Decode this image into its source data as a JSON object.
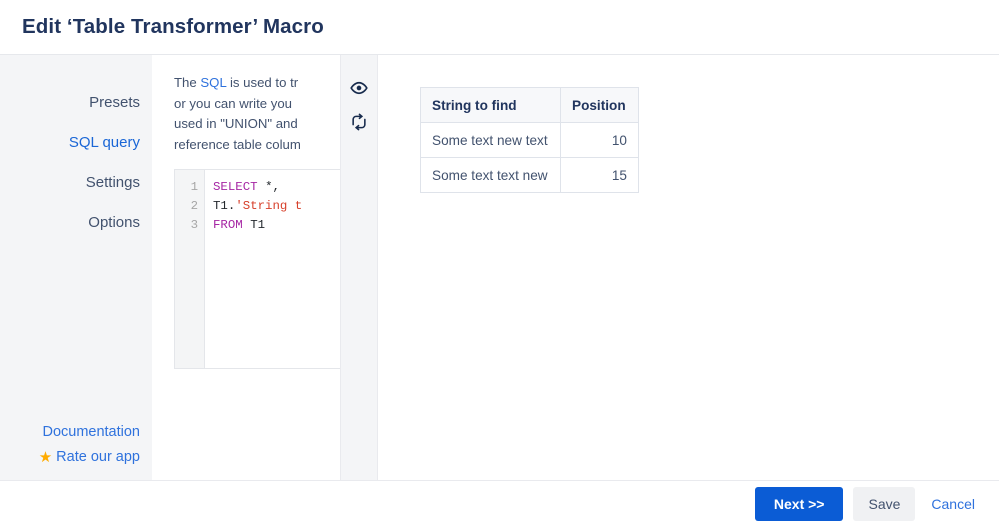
{
  "header": {
    "title": "Edit ‘Table Transformer’ Macro"
  },
  "sidebar": {
    "items": [
      {
        "label": "Presets",
        "active": false
      },
      {
        "label": "SQL query",
        "active": true
      },
      {
        "label": "Settings",
        "active": false
      },
      {
        "label": "Options",
        "active": false
      }
    ],
    "footer": {
      "documentation_label": "Documentation",
      "rate_label": "Rate our app",
      "star_glyph": "★",
      "star_icon_name": "star-icon",
      "star_color": "#ffab00"
    }
  },
  "config": {
    "description_lines": [
      {
        "pre": "The ",
        "link": "SQL",
        "post": " is used to tr"
      },
      {
        "pre": "or you can write you",
        "link": "",
        "post": ""
      },
      {
        "pre": "used in \"UNION\" and",
        "link": "",
        "post": ""
      },
      {
        "pre": "reference table colum",
        "link": "",
        "post": ""
      }
    ],
    "editor": {
      "line_numbers": [
        "1",
        "2",
        "3"
      ],
      "lines": [
        [
          {
            "t": "SELECT",
            "c": "kw"
          },
          {
            "t": " ",
            "c": "op"
          },
          {
            "t": "*,",
            "c": "op"
          }
        ],
        [
          {
            "t": "T1.",
            "c": "id"
          },
          {
            "t": "'String t",
            "c": "str"
          }
        ],
        [
          {
            "t": "FROM",
            "c": "kw"
          },
          {
            "t": " ",
            "c": "op"
          },
          {
            "t": "T1",
            "c": "id"
          }
        ]
      ]
    }
  },
  "icon_rail": {
    "icons": [
      {
        "name": "preview-eye-icon",
        "title": "Preview"
      },
      {
        "name": "refresh-swap-icon",
        "title": "Refresh"
      }
    ]
  },
  "preview": {
    "table": {
      "columns": [
        "String to find",
        "Position"
      ],
      "rows": [
        [
          "Some text new text",
          "10"
        ],
        [
          "Some text text new",
          "15"
        ]
      ]
    }
  },
  "footer": {
    "next_label": "Next >>",
    "save_label": "Save",
    "cancel_label": "Cancel",
    "primary_color": "#0b5cd5",
    "link_color": "#2f72dd"
  }
}
